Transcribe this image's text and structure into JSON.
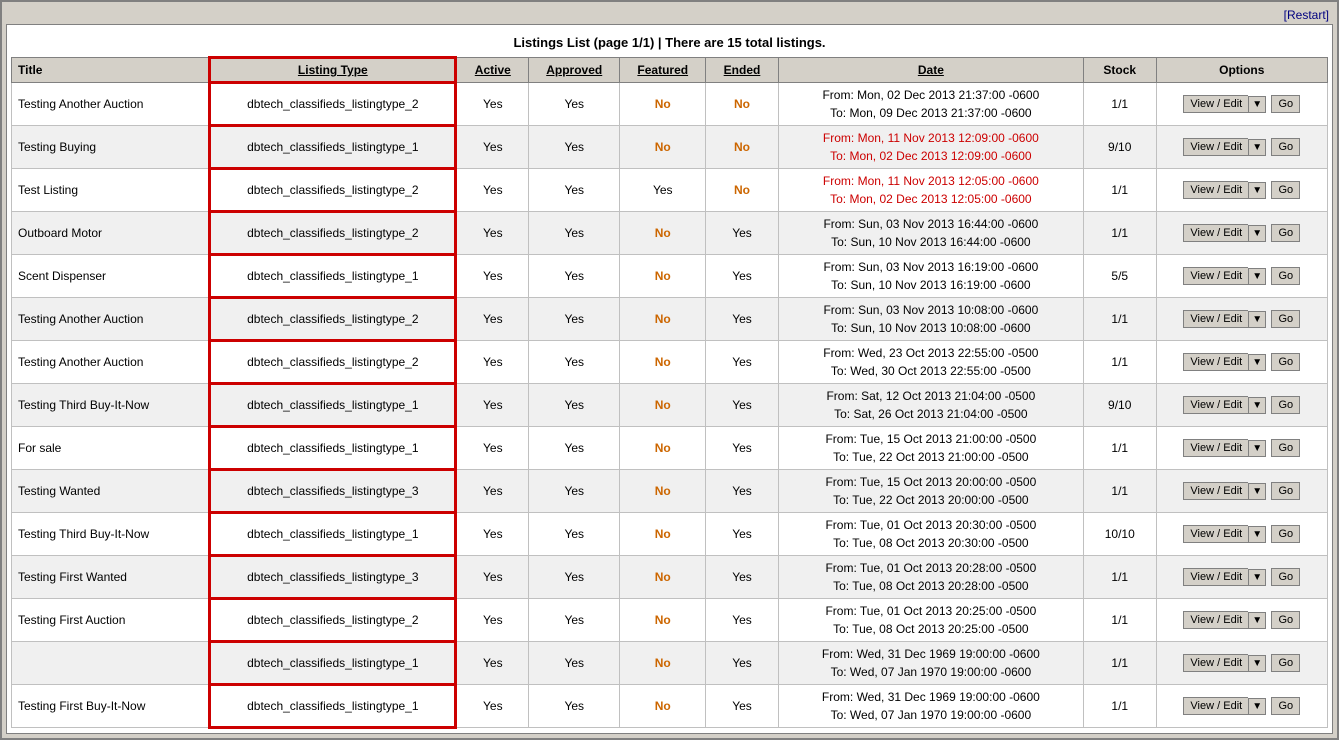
{
  "app": {
    "restart_label": "[Restart]",
    "page_title": "Listings List (page 1/1) | There are 15 total listings."
  },
  "table": {
    "headers": {
      "title": "Title",
      "listing_type": "Listing Type",
      "active": "Active",
      "approved": "Approved",
      "featured": "Featured",
      "ended": "Ended",
      "date": "Date",
      "stock": "Stock",
      "options": "Options"
    },
    "rows": [
      {
        "title": "Testing Another Auction",
        "listing_type": "dbtech_classifieds_listingtype_2",
        "active": "Yes",
        "approved": "Yes",
        "featured": "No",
        "featured_red": true,
        "ended": "No",
        "ended_red": true,
        "date_from": "From: Mon, 02 Dec 2013 21:37:00 -0600",
        "date_to": "To: Mon, 09 Dec 2013 21:37:00 -0600",
        "date_red": false,
        "stock": "1/1"
      },
      {
        "title": "Testing Buying",
        "listing_type": "dbtech_classifieds_listingtype_1",
        "active": "Yes",
        "approved": "Yes",
        "featured": "No",
        "featured_red": true,
        "ended": "No",
        "ended_red": true,
        "date_from": "From: Mon, 11 Nov 2013 12:09:00 -0600",
        "date_to": "To: Mon, 02 Dec 2013 12:09:00 -0600",
        "date_red": true,
        "stock": "9/10"
      },
      {
        "title": "Test Listing",
        "listing_type": "dbtech_classifieds_listingtype_2",
        "active": "Yes",
        "approved": "Yes",
        "featured": "Yes",
        "featured_red": false,
        "ended": "No",
        "ended_red": true,
        "date_from": "From: Mon, 11 Nov 2013 12:05:00 -0600",
        "date_to": "To: Mon, 02 Dec 2013 12:05:00 -0600",
        "date_red": true,
        "stock": "1/1"
      },
      {
        "title": "Outboard Motor",
        "listing_type": "dbtech_classifieds_listingtype_2",
        "active": "Yes",
        "approved": "Yes",
        "featured": "No",
        "featured_red": true,
        "ended": "Yes",
        "ended_red": false,
        "date_from": "From: Sun, 03 Nov 2013 16:44:00 -0600",
        "date_to": "To: Sun, 10 Nov 2013 16:44:00 -0600",
        "date_red": false,
        "stock": "1/1"
      },
      {
        "title": "Scent Dispenser",
        "listing_type": "dbtech_classifieds_listingtype_1",
        "active": "Yes",
        "approved": "Yes",
        "featured": "No",
        "featured_red": true,
        "ended": "Yes",
        "ended_red": false,
        "date_from": "From: Sun, 03 Nov 2013 16:19:00 -0600",
        "date_to": "To: Sun, 10 Nov 2013 16:19:00 -0600",
        "date_red": false,
        "stock": "5/5"
      },
      {
        "title": "Testing Another Auction",
        "listing_type": "dbtech_classifieds_listingtype_2",
        "active": "Yes",
        "approved": "Yes",
        "featured": "No",
        "featured_red": true,
        "ended": "Yes",
        "ended_red": false,
        "date_from": "From: Sun, 03 Nov 2013 10:08:00 -0600",
        "date_to": "To: Sun, 10 Nov 2013 10:08:00 -0600",
        "date_red": false,
        "stock": "1/1"
      },
      {
        "title": "Testing Another Auction",
        "listing_type": "dbtech_classifieds_listingtype_2",
        "active": "Yes",
        "approved": "Yes",
        "featured": "No",
        "featured_red": true,
        "ended": "Yes",
        "ended_red": false,
        "date_from": "From: Wed, 23 Oct 2013 22:55:00 -0500",
        "date_to": "To: Wed, 30 Oct 2013 22:55:00 -0500",
        "date_red": false,
        "stock": "1/1"
      },
      {
        "title": "Testing Third Buy-It-Now",
        "listing_type": "dbtech_classifieds_listingtype_1",
        "active": "Yes",
        "approved": "Yes",
        "featured": "No",
        "featured_red": true,
        "ended": "Yes",
        "ended_red": false,
        "date_from": "From: Sat, 12 Oct 2013 21:04:00 -0500",
        "date_to": "To: Sat, 26 Oct 2013 21:04:00 -0500",
        "date_red": false,
        "stock": "9/10"
      },
      {
        "title": "For sale",
        "listing_type": "dbtech_classifieds_listingtype_1",
        "active": "Yes",
        "approved": "Yes",
        "featured": "No",
        "featured_red": true,
        "ended": "Yes",
        "ended_red": false,
        "date_from": "From: Tue, 15 Oct 2013 21:00:00 -0500",
        "date_to": "To: Tue, 22 Oct 2013 21:00:00 -0500",
        "date_red": false,
        "stock": "1/1"
      },
      {
        "title": "Testing Wanted",
        "listing_type": "dbtech_classifieds_listingtype_3",
        "active": "Yes",
        "approved": "Yes",
        "featured": "No",
        "featured_red": true,
        "ended": "Yes",
        "ended_red": false,
        "date_from": "From: Tue, 15 Oct 2013 20:00:00 -0500",
        "date_to": "To: Tue, 22 Oct 2013 20:00:00 -0500",
        "date_red": false,
        "stock": "1/1"
      },
      {
        "title": "Testing Third Buy-It-Now",
        "listing_type": "dbtech_classifieds_listingtype_1",
        "active": "Yes",
        "approved": "Yes",
        "featured": "No",
        "featured_red": true,
        "ended": "Yes",
        "ended_red": false,
        "date_from": "From: Tue, 01 Oct 2013 20:30:00 -0500",
        "date_to": "To: Tue, 08 Oct 2013 20:30:00 -0500",
        "date_red": false,
        "stock": "10/10"
      },
      {
        "title": "Testing First Wanted",
        "listing_type": "dbtech_classifieds_listingtype_3",
        "active": "Yes",
        "approved": "Yes",
        "featured": "No",
        "featured_red": true,
        "ended": "Yes",
        "ended_red": false,
        "date_from": "From: Tue, 01 Oct 2013 20:28:00 -0500",
        "date_to": "To: Tue, 08 Oct 2013 20:28:00 -0500",
        "date_red": false,
        "stock": "1/1"
      },
      {
        "title": "Testing First Auction",
        "listing_type": "dbtech_classifieds_listingtype_2",
        "active": "Yes",
        "approved": "Yes",
        "featured": "No",
        "featured_red": true,
        "ended": "Yes",
        "ended_red": false,
        "date_from": "From: Tue, 01 Oct 2013 20:25:00 -0500",
        "date_to": "To: Tue, 08 Oct 2013 20:25:00 -0500",
        "date_red": false,
        "stock": "1/1"
      },
      {
        "title": "",
        "listing_type": "dbtech_classifieds_listingtype_1",
        "active": "Yes",
        "approved": "Yes",
        "featured": "No",
        "featured_red": true,
        "ended": "Yes",
        "ended_red": false,
        "date_from": "From: Wed, 31 Dec 1969 19:00:00 -0600",
        "date_to": "To: Wed, 07 Jan 1970 19:00:00 -0600",
        "date_red": false,
        "stock": "1/1"
      },
      {
        "title": "Testing First Buy-It-Now",
        "listing_type": "dbtech_classifieds_listingtype_1",
        "active": "Yes",
        "approved": "Yes",
        "featured": "No",
        "featured_red": true,
        "ended": "Yes",
        "ended_red": false,
        "date_from": "From: Wed, 31 Dec 1969 19:00:00 -0600",
        "date_to": "To: Wed, 07 Jan 1970 19:00:00 -0600",
        "date_red": false,
        "stock": "1/1"
      }
    ]
  },
  "buttons": {
    "view_edit": "View / Edit",
    "dropdown_arrow": "▼",
    "go": "Go",
    "restart": "[Restart]"
  }
}
